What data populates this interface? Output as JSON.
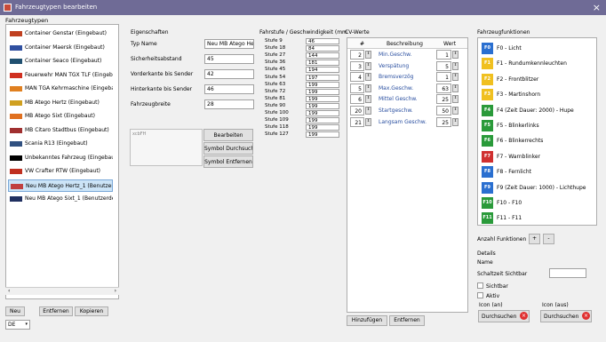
{
  "window": {
    "title": "Fahrzeugtypen bearbeiten",
    "close": "×"
  },
  "vehicles": {
    "header": "Fahrzeugtypen",
    "items": [
      {
        "label": "Container Genstar (Eingebaut)",
        "color": "#c04020"
      },
      {
        "label": "Container Maersk (Eingebaut)",
        "color": "#3050a0"
      },
      {
        "label": "Container Seaco (Eingebaut)",
        "color": "#205070"
      },
      {
        "label": "Feuerwehr MAN TGX TLF (Eingeb",
        "color": "#d03020"
      },
      {
        "label": "MAN TGA Kehrmaschine (Eingeba",
        "color": "#e08020"
      },
      {
        "label": "MB Atego Hertz (Eingebaut)",
        "color": "#d0a020"
      },
      {
        "label": "MB Atego Sixt (Eingebaut)",
        "color": "#e07020"
      },
      {
        "label": "MB Citaro Stadtbus (Eingebaut)",
        "color": "#a03030"
      },
      {
        "label": "Scania R13 (Eingebaut)",
        "color": "#305080"
      },
      {
        "label": "Unbekanntes Fahrzeug (Eingebaut",
        "color": "#000000"
      },
      {
        "label": "VW Crafter RTW (Eingebaut)",
        "color": "#c03020"
      },
      {
        "label": "Neu MB Atego Hertz_1 (Benutzerd",
        "color": "#c04040"
      },
      {
        "label": "Neu MB Atego Sixt_1 (Benutzerdef",
        "color": "#203060"
      }
    ],
    "selected_index": 11,
    "buttons": {
      "new": "Neu",
      "remove": "Entfernen",
      "copy": "Kopieren"
    },
    "language": "DE"
  },
  "properties": {
    "header": "Eigenschaften",
    "type_name_label": "Typ Name",
    "type_name_value": "Neu MB Atego Her",
    "safety_label": "Sicherheitsabstand",
    "safety_value": "45",
    "front_label": "Vorderkante bis Sender",
    "front_value": "42",
    "rear_label": "Hinterkante bis Sender",
    "rear_value": "46",
    "width_label": "Fahrzeugbreite",
    "width_value": "28",
    "symbol_name": "xcbFH",
    "edit_btn": "Bearbeiten",
    "search_btn": "Symbol Durchsuch",
    "remove_btn": "Symbol Entfernen"
  },
  "speeds": {
    "header": "Fahrstufe / Geschwindigkeit (mm",
    "rows": [
      {
        "label": "Stufe 9",
        "value": "46"
      },
      {
        "label": "Stufe 18",
        "value": "84"
      },
      {
        "label": "Stufe 27",
        "value": "144"
      },
      {
        "label": "Stufe 36",
        "value": "181"
      },
      {
        "label": "Stufe 45",
        "value": "194"
      },
      {
        "label": "Stufe 54",
        "value": "197"
      },
      {
        "label": "Stufe 63",
        "value": "199"
      },
      {
        "label": "Stufe 72",
        "value": "199"
      },
      {
        "label": "Stufe 81",
        "value": "199"
      },
      {
        "label": "Stufe 90",
        "value": "199"
      },
      {
        "label": "Stufe 100",
        "value": "199"
      },
      {
        "label": "Stufe 109",
        "value": "199"
      },
      {
        "label": "Stufe 118",
        "value": "199"
      },
      {
        "label": "Stufe 127",
        "value": "199"
      }
    ]
  },
  "cv": {
    "header": "CV-Werte",
    "col_num": "#",
    "col_desc": "Beschreibung",
    "col_val": "Wert",
    "rows": [
      {
        "num": "2",
        "desc": "Min.Geschw.",
        "val": "1"
      },
      {
        "num": "3",
        "desc": "Verspätung",
        "val": "5"
      },
      {
        "num": "4",
        "desc": "Bremsverzög",
        "val": "1"
      },
      {
        "num": "5",
        "desc": "Max.Geschw.",
        "val": "63"
      },
      {
        "num": "6",
        "desc": "Mittel Geschw.",
        "val": "25"
      },
      {
        "num": "20",
        "desc": "Startgeschw.",
        "val": "50"
      },
      {
        "num": "21",
        "desc": "Langsam Geschw.",
        "val": "25"
      }
    ],
    "add_btn": "Hinzufügen",
    "remove_btn": "Entfernen"
  },
  "functions": {
    "header": "Fahrzeugfunktionen",
    "items": [
      {
        "icon": "F0",
        "label": "F0 - Licht",
        "color": "#2a6fd0"
      },
      {
        "icon": "F1",
        "label": "F1 - Rundumkennleuchten",
        "color": "#f0c020"
      },
      {
        "icon": "F2",
        "label": "F2 - Frontblitzer",
        "color": "#f0c020"
      },
      {
        "icon": "F3",
        "label": "F3 - Martinshorn",
        "color": "#f0c020"
      },
      {
        "icon": "F4",
        "label": "F4 (Zeit Dauer: 2000) - Hupe",
        "color": "#2a9a3a"
      },
      {
        "icon": "F5",
        "label": "F5 - Blinkerlinks",
        "color": "#2a9a3a"
      },
      {
        "icon": "F6",
        "label": "F6 - Blinkerrechts",
        "color": "#2a9a3a"
      },
      {
        "icon": "F7",
        "label": "F7 - Warnblinker",
        "color": "#d03030"
      },
      {
        "icon": "F8",
        "label": "F8 - Fernlicht",
        "color": "#2a6fd0"
      },
      {
        "icon": "F9",
        "label": "F9 (Zeit Dauer: 1000) - Lichthupe",
        "color": "#2a6fd0"
      },
      {
        "icon": "F10",
        "label": "F10 - F10",
        "color": "#2a9a3a"
      },
      {
        "icon": "F11",
        "label": "F11 - F11",
        "color": "#2a9a3a"
      }
    ],
    "count_label": "Anzahl Funktionen",
    "plus": "+",
    "minus": "-",
    "details_header": "Details",
    "name_label": "Name",
    "time_label": "Schaltzeit Sichtbar",
    "visible_label": "Sichtbar",
    "active_label": "Aktiv",
    "icon_on_label": "Icon (an)",
    "icon_off_label": "Icon (aus)",
    "browse_on": "Durchsuchen",
    "browse_off": "Durchsuchen"
  }
}
